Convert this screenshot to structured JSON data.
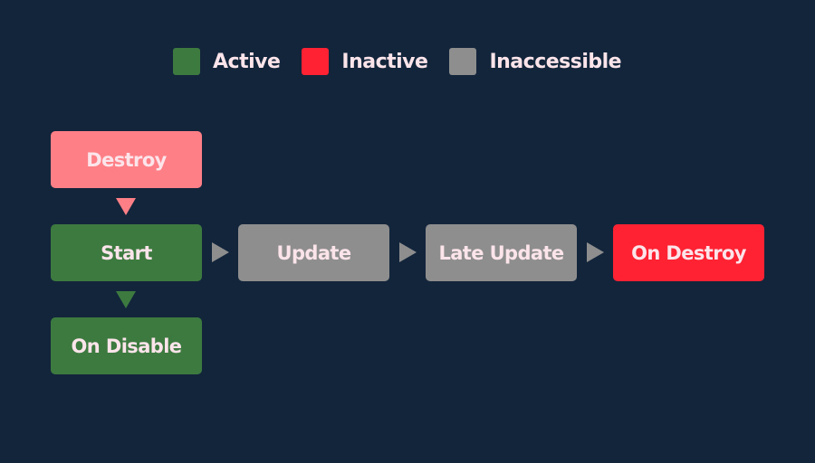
{
  "colors": {
    "background": "#12253b",
    "active": "#3d7a40",
    "inactive": "#ff2233",
    "inaccessible": "#8e8e8e",
    "destroy_pink": "#ff7f86",
    "text": "#fbe4ea"
  },
  "legend": [
    {
      "label": "Active",
      "color": "#3d7a40"
    },
    {
      "label": "Inactive",
      "color": "#ff2233"
    },
    {
      "label": "Inaccessible",
      "color": "#8e8e8e"
    }
  ],
  "nodes": {
    "destroy": {
      "label": "Destroy",
      "state": "highlight",
      "color": "#ff7f86"
    },
    "start": {
      "label": "Start",
      "state": "active",
      "color": "#3d7a40"
    },
    "on_disable": {
      "label": "On Disable",
      "state": "active",
      "color": "#3d7a40"
    },
    "update": {
      "label": "Update",
      "state": "inaccessible",
      "color": "#8e8e8e"
    },
    "late_update": {
      "label": "Late Update",
      "state": "inaccessible",
      "color": "#8e8e8e"
    },
    "on_destroy": {
      "label": "On Destroy",
      "state": "inactive",
      "color": "#ff2233"
    }
  },
  "edges": [
    {
      "from": "Destroy",
      "to": "Start",
      "color": "#ff7f86"
    },
    {
      "from": "Start",
      "to": "On Disable",
      "color": "#3d7a40"
    },
    {
      "from": "Start",
      "to": "Update",
      "color": "#8e8e8e"
    },
    {
      "from": "Update",
      "to": "Late Update",
      "color": "#8e8e8e"
    },
    {
      "from": "Late Update",
      "to": "On Destroy",
      "color": "#8e8e8e"
    }
  ]
}
